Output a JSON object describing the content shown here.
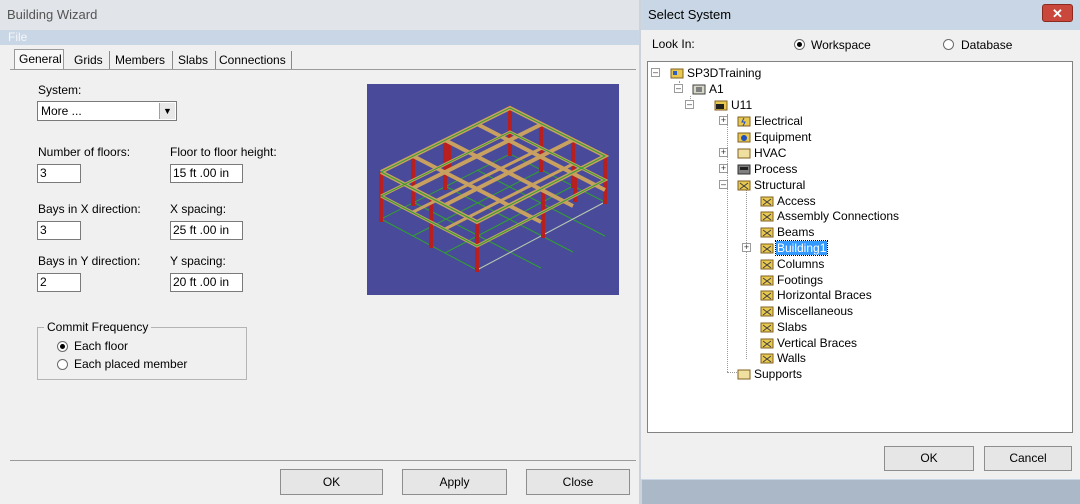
{
  "building_wizard": {
    "title": "Building Wizard",
    "menu_file": "File",
    "tabs": [
      "General",
      "Grids",
      "Members",
      "Slabs",
      "Connections"
    ],
    "system_label": "System:",
    "system_value": "More ...",
    "num_floors_label": "Number of floors:",
    "num_floors_value": "3",
    "floor_height_label": "Floor to floor height:",
    "floor_height_value": "15 ft  .00 in",
    "bays_x_label": "Bays in X direction:",
    "bays_x_value": "3",
    "x_spacing_label": "X spacing:",
    "x_spacing_value": "25 ft  .00 in",
    "bays_y_label": "Bays in Y direction:",
    "bays_y_value": "2",
    "y_spacing_label": "Y spacing:",
    "y_spacing_value": "20 ft  .00 in",
    "commit_frequency_label": "Commit Frequency",
    "commit_each_floor": "Each floor",
    "commit_each_member": "Each placed member",
    "ok": "OK",
    "apply": "Apply",
    "close": "Close"
  },
  "select_system": {
    "title": "Select System",
    "look_in": "Look In:",
    "workspace": "Workspace",
    "database": "Database",
    "selected_option": "Workspace",
    "tree": [
      {
        "label": "SP3DTraining"
      },
      {
        "label": "A1"
      },
      {
        "label": "U11"
      },
      {
        "label": "Electrical"
      },
      {
        "label": "Equipment"
      },
      {
        "label": "HVAC"
      },
      {
        "label": "Process"
      },
      {
        "label": "Structural"
      },
      {
        "label": "Access"
      },
      {
        "label": "Assembly Connections"
      },
      {
        "label": "Beams"
      },
      {
        "label": "Building1"
      },
      {
        "label": "Columns"
      },
      {
        "label": "Footings"
      },
      {
        "label": "Horizontal Braces"
      },
      {
        "label": "Miscellaneous"
      },
      {
        "label": "Slabs"
      },
      {
        "label": "Vertical Braces"
      },
      {
        "label": "Walls"
      },
      {
        "label": "Supports"
      }
    ],
    "selected_node": "Building1",
    "ok": "OK",
    "cancel": "Cancel"
  },
  "colors": {
    "preview_bg": "#4a4a9a",
    "beam": "#c8a060",
    "column": "#b82020",
    "grid_line": "#30a030",
    "selection": "#3399ff"
  }
}
